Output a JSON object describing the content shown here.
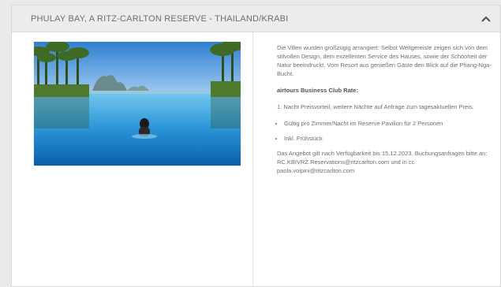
{
  "header": {
    "title": "PHULAY BAY, A RITZ-CARLTON RESERVE - THAILAND/KRABI",
    "toggle_icon": "chevron-up-icon"
  },
  "body": {
    "intro": "Die Villen wurden großzügig arrangiert: Selbst Weltgereiste zeigen sich von dem stilvollen Design, dem exzellenten Service des Hauses, sowie der Schönheit der Natur beeindruckt. Vom Resort aus genießen Gäste den Blick auf die Phang-Nga-Bucht.",
    "rate_heading": "airtours Business Club Rate:",
    "rate_text": "1. Nacht Preisvorteil, weitere Nächte auf Anfrage zum tagesaktuellen Preis.",
    "bullets": [
      "Gültig pro Zimmer/Nacht im Reserve Pavilion für 2 Personen",
      "Inkl. Frühstück"
    ],
    "offer_text": "Das Angebot gilt nach Verfügbarkeit bis 15.12.2023. Buchungsanfragen bitte an: RC.KBIVRZ.Reservations@ritzcarlton.com und in cc paola.volpini@ritzcarlton.com"
  }
}
